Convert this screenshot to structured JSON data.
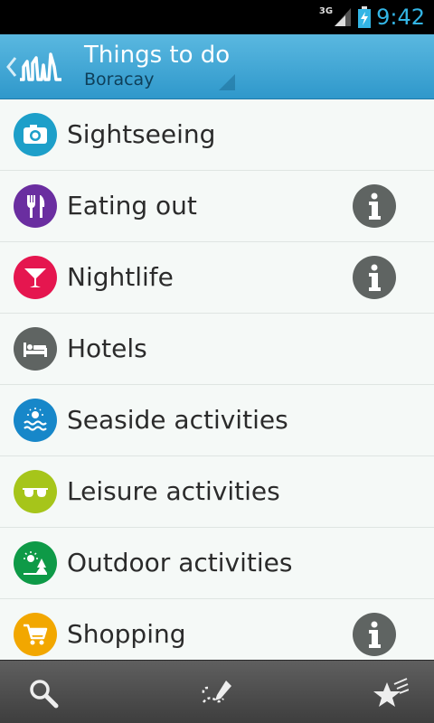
{
  "status_bar": {
    "network": "3G",
    "time": "9:42",
    "clock_color": "#33b5e5"
  },
  "header": {
    "title": "Things to do",
    "subtitle": "Boracay",
    "bar_color": "#3aa3d4"
  },
  "list": {
    "items": [
      {
        "label": "Sightseeing",
        "icon": "camera-icon",
        "color": "#1d9fc9",
        "info": false
      },
      {
        "label": "Eating out",
        "icon": "fork-knife-icon",
        "color": "#6a2ea0",
        "info": true
      },
      {
        "label": "Nightlife",
        "icon": "cocktail-icon",
        "color": "#e5164f",
        "info": true
      },
      {
        "label": "Hotels",
        "icon": "bed-icon",
        "color": "#5f6462",
        "info": false
      },
      {
        "label": "Seaside activities",
        "icon": "sun-waves-icon",
        "color": "#1787c9",
        "info": false
      },
      {
        "label": "Leisure activities",
        "icon": "sunglasses-icon",
        "color": "#a6c51a",
        "info": false
      },
      {
        "label": "Outdoor activities",
        "icon": "sun-tree-icon",
        "color": "#0e9a47",
        "info": false
      },
      {
        "label": "Shopping",
        "icon": "cart-icon",
        "color": "#f2a700",
        "info": true
      }
    ]
  },
  "bottom_bar": {
    "buttons": [
      "search-icon",
      "route-pencil-icon",
      "favorites-stars-icon"
    ]
  }
}
